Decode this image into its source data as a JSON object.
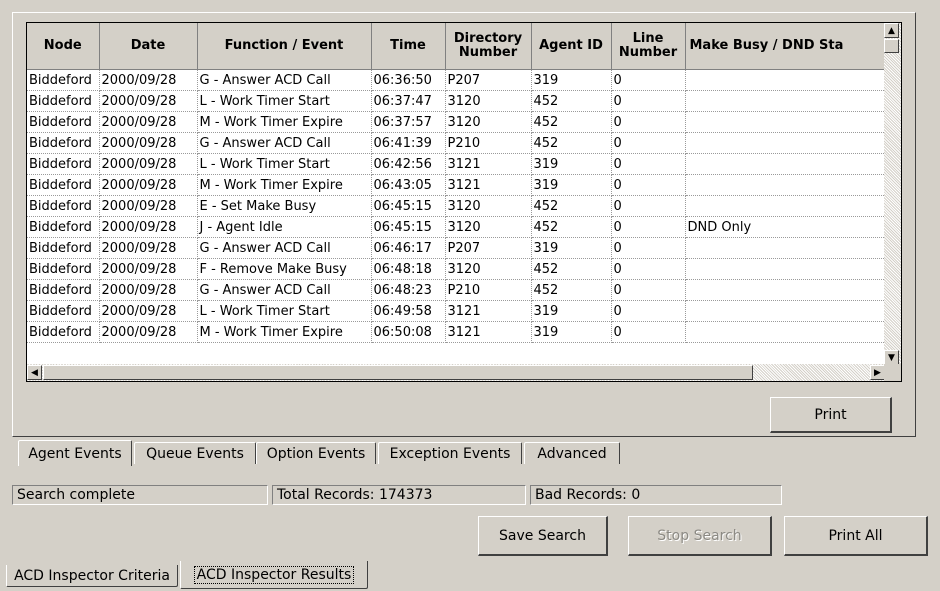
{
  "grid": {
    "columns": [
      "Node",
      "Date",
      "Function / Event",
      "Time",
      "Directory Number",
      "Agent ID",
      "Line Number",
      "Make Busy / DND Sta"
    ],
    "rows": [
      [
        "Biddeford",
        "2000/09/28",
        "G - Answer ACD Call",
        "06:36:50",
        "P207",
        "319",
        "0",
        ""
      ],
      [
        "Biddeford",
        "2000/09/28",
        "L - Work Timer Start",
        "06:37:47",
        "3120",
        "452",
        "0",
        ""
      ],
      [
        "Biddeford",
        "2000/09/28",
        "M - Work Timer Expire",
        "06:37:57",
        "3120",
        "452",
        "0",
        ""
      ],
      [
        "Biddeford",
        "2000/09/28",
        "G - Answer ACD Call",
        "06:41:39",
        "P210",
        "452",
        "0",
        ""
      ],
      [
        "Biddeford",
        "2000/09/28",
        "L - Work Timer Start",
        "06:42:56",
        "3121",
        "319",
        "0",
        ""
      ],
      [
        "Biddeford",
        "2000/09/28",
        "M - Work Timer Expire",
        "06:43:05",
        "3121",
        "319",
        "0",
        ""
      ],
      [
        "Biddeford",
        "2000/09/28",
        "E - Set Make Busy",
        "06:45:15",
        "3120",
        "452",
        "0",
        ""
      ],
      [
        "Biddeford",
        "2000/09/28",
        "J - Agent Idle",
        "06:45:15",
        "3120",
        "452",
        "0",
        "DND Only"
      ],
      [
        "Biddeford",
        "2000/09/28",
        "G - Answer ACD Call",
        "06:46:17",
        "P207",
        "319",
        "0",
        ""
      ],
      [
        "Biddeford",
        "2000/09/28",
        "F - Remove Make Busy",
        "06:48:18",
        "3120",
        "452",
        "0",
        ""
      ],
      [
        "Biddeford",
        "2000/09/28",
        "G - Answer ACD Call",
        "06:48:23",
        "P210",
        "452",
        "0",
        ""
      ],
      [
        "Biddeford",
        "2000/09/28",
        "L - Work Timer Start",
        "06:49:58",
        "3121",
        "319",
        "0",
        ""
      ],
      [
        "Biddeford",
        "2000/09/28",
        "M - Work Timer Expire",
        "06:50:08",
        "3121",
        "319",
        "0",
        ""
      ]
    ]
  },
  "print_label": "Print",
  "event_tabs": [
    "Agent Events",
    "Queue Events",
    "Option Events",
    "Exception Events",
    "Advanced"
  ],
  "status": {
    "message": "Search complete",
    "total_records": "Total Records: 174373",
    "bad_records": "Bad Records: 0"
  },
  "actions": {
    "save_search": "Save Search",
    "stop_search": "Stop Search",
    "print_all": "Print All"
  },
  "window_tabs": [
    "ACD Inspector Criteria",
    "ACD Inspector Results"
  ],
  "icons": {
    "up": "scroll-up-arrow-icon",
    "down": "scroll-down-arrow-icon",
    "left": "scroll-left-arrow-icon",
    "right": "scroll-right-arrow-icon"
  }
}
